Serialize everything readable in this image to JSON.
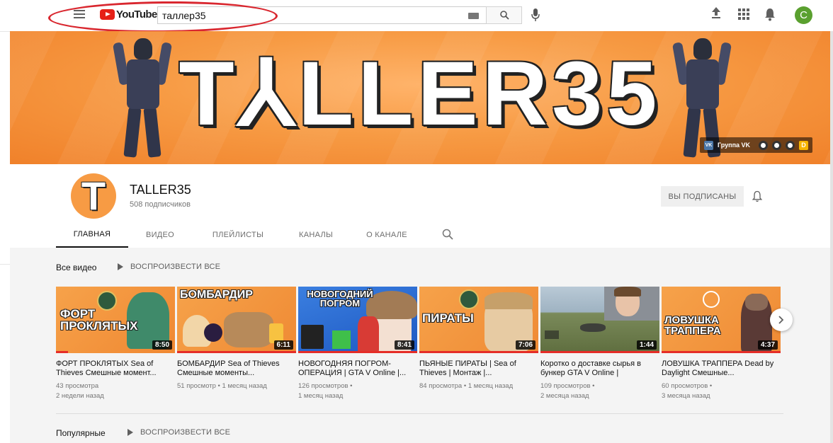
{
  "masthead": {
    "logo_text": "YouTube",
    "logo_region": "RU",
    "search_value": "таллер35",
    "avatar_letter": "C"
  },
  "banner": {
    "title": "T⅄LLER35",
    "vk_label": "Группа VK",
    "vk_badge": "VK",
    "d_icon": "D"
  },
  "channel": {
    "avatar_letter": "T",
    "name": "TALLER35",
    "subscribers": "508 подписчиков",
    "subscribe_button": "ВЫ ПОДПИСАНЫ"
  },
  "tabs": [
    {
      "label": "ГЛАВНАЯ",
      "active": true
    },
    {
      "label": "ВИДЕО",
      "active": false
    },
    {
      "label": "ПЛЕЙЛИСТЫ",
      "active": false
    },
    {
      "label": "КАНАЛЫ",
      "active": false
    },
    {
      "label": "О КАНАЛЕ",
      "active": false
    }
  ],
  "section_all": {
    "title": "Все видео",
    "play_all": "ВОСПРОИЗВЕСТИ ВСЕ"
  },
  "videos": [
    {
      "thumb_text": "ФОРТ ПРОКЛЯТЫХ",
      "duration": "8:50",
      "title": "ФОРТ ПРОКЛЯТЫХ Sea of Thieves Смешные момент...",
      "views": "43 просмотра",
      "age": "2 недели назад",
      "watched": 0.1
    },
    {
      "thumb_text": "БОМБАРДИР",
      "duration": "6:11",
      "title": "БОМБАРДИР Sea of Thieves Смешные моменты...",
      "views": "51 просмотр",
      "age": "1 месяц назад",
      "watched": 1.0
    },
    {
      "thumb_text": "НОВОГОДНИЙ ПОГРОМ",
      "duration": "8:41",
      "title": "НОВОГОДНЯЯ ПОГРОМ-ОПЕРАЦИЯ | GTA V Online |...",
      "views": "126 просмотров",
      "age": "1 месяц назад",
      "watched": 1.0
    },
    {
      "thumb_text": "ПИРАТЫ",
      "duration": "7:06",
      "title": "ПЬЯНЫЕ ПИРАТЫ | Sea of Thieves | Монтаж |...",
      "views": "84 просмотра",
      "age": "1 месяц назад",
      "watched": 1.0
    },
    {
      "thumb_text": "",
      "duration": "1:44",
      "title": "Коротко о доставке сырья в бункер GTA V Online |",
      "views": "109 просмотров",
      "age": "2 месяца назад",
      "watched": 1.0
    },
    {
      "thumb_text": "ЛОВУШКА ТРАППЕРА",
      "duration": "4:37",
      "title": "ЛОВУШКА ТРАППЕРА Dead by Daylight Смешные...",
      "views": "60 просмотров",
      "age": "3 месяца назад",
      "watched": 1.0
    }
  ],
  "section_popular": {
    "title": "Популярные",
    "play_all": "ВОСПРОИЗВЕСТИ ВСЕ"
  },
  "colors": {
    "brand_red": "#e62117",
    "banner_orange": "#f79b44",
    "progress_red": "#e52d27",
    "annotation_red": "#d9272f"
  }
}
